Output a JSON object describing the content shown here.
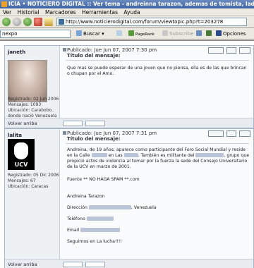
{
  "window": {
    "title": "ICIA • NOTICIERO DIGITAL :: Ver tema - andreinna tarazon, ademas de tomista, ladrona... - Iceweasel"
  },
  "menu": [
    "Ver",
    "Historial",
    "Marcadores",
    "Herramientas",
    "Ayuda"
  ],
  "address": {
    "url": "http://www.noticierodigital.com/forum/viewtopic.php?t=203278"
  },
  "searchbar": {
    "query": "nexpo",
    "search_label": "Buscar",
    "pagerank_label": "PageRank",
    "subscribe_label": "Subscribe",
    "options_label": "Opciones"
  },
  "posts": [
    {
      "author": "janeth",
      "registered": "Registrado: 02 Jun 2006",
      "messages": "Mensajes: 1093",
      "location": "Ubicación: Carabobo.. donde nació Venezuela",
      "date": "Publicado: Jue Jun 07, 2007 7:30 pm",
      "title_label": "Título del mensaje:",
      "text": "Que mas se puede esperar de una joven que no piensa, ella es de las que brincan o chupan por el Amo.",
      "back": "Volver arriba"
    },
    {
      "author": "lalita",
      "registered": "Registrado: 05 Dic 2006",
      "messages": "Mensajes: 67",
      "location": "Ubicación: Caracas",
      "date": "Publicado: Jue Jun 07, 2007 7:31 pm",
      "title_label": "Título del mensaje:",
      "p1a": "Andreina, de 19 años, aparece como participante del Foro Social Mundial y reside en la Calle",
      "p1b": "en Las",
      "p1c": "También es militante del",
      "p1d": ", grupo que propició actos de violencia al tomar por la fuerza la sede del Consejo Universitario de la UCV en marzo de 2001.",
      "fuente": "Fuente ** NO HAGA SPAM **.com",
      "name": "Andreina Tarazon",
      "direccion": "Dirección",
      "venezuela": ", Venezuela",
      "telefono": "Teléfono",
      "email": "Email",
      "closing": "Seguimos en La lucha!!!!",
      "back": "Volver arriba",
      "avatar_text": "UCV"
    }
  ]
}
